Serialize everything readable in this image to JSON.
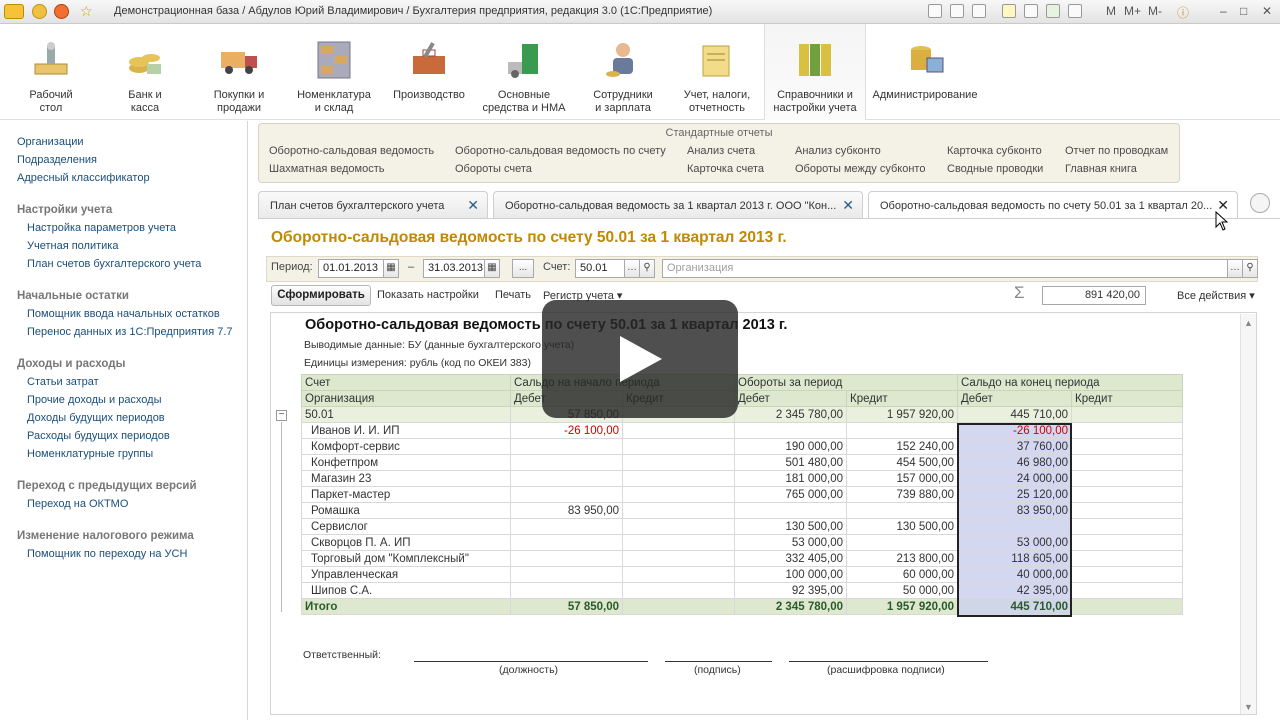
{
  "window": {
    "title": "Демонстрационная база / Абдулов Юрий Владимирович / Бухгалтерия предприятия, редакция 3.0  (1С:Предприятие)",
    "m_buttons": [
      "M",
      "M+",
      "M-"
    ]
  },
  "sections": [
    {
      "label": "Рабочий\nстол",
      "icon": "desktop-icon"
    },
    {
      "label": "Банк и\nкасса",
      "icon": "coins-icon"
    },
    {
      "label": "Покупки и\nпродажи",
      "icon": "truck-icon"
    },
    {
      "label": "Номенклатура\nи склад",
      "icon": "warehouse-icon"
    },
    {
      "label": "Производство",
      "icon": "toolbox-icon"
    },
    {
      "label": "Основные\nсредства и НМА",
      "icon": "fixed-assets-icon"
    },
    {
      "label": "Сотрудники\nи зарплата",
      "icon": "employee-icon"
    },
    {
      "label": "Учет, налоги,\nотчетность",
      "icon": "reports-icon"
    },
    {
      "label": "Справочники и\nнастройки учета",
      "icon": "binders-icon"
    },
    {
      "label": "Администрирование",
      "icon": "admin-icon"
    }
  ],
  "leftnav": {
    "top_links": [
      "Организации",
      "Подразделения",
      "Адресный классификатор"
    ],
    "groups": [
      {
        "title": "Настройки учета",
        "links": [
          "Настройка параметров учета",
          "Учетная политика",
          "План счетов бухгалтерского учета"
        ]
      },
      {
        "title": "Начальные остатки",
        "links": [
          "Помощник ввода начальных остатков",
          "Перенос данных из 1С:Предприятия 7.7"
        ]
      },
      {
        "title": "Доходы и расходы",
        "links": [
          "Статьи затрат",
          "Прочие доходы и расходы",
          "Доходы будущих периодов",
          "Расходы будущих периодов",
          "Номенклатурные группы"
        ]
      },
      {
        "title": "Переход с предыдущих версий",
        "links": [
          "Переход на ОКТМО"
        ]
      },
      {
        "title": "Изменение налогового режима",
        "links": [
          "Помощник по переходу на УСН"
        ]
      }
    ]
  },
  "std_reports": {
    "title": "Стандартные отчеты",
    "col1": [
      "Оборотно-сальдовая ведомость",
      "Шахматная ведомость"
    ],
    "col2": [
      "Оборотно-сальдовая ведомость по счету",
      "Обороты счета"
    ],
    "col3": [
      "Анализ счета",
      "Карточка счета"
    ],
    "col4": [
      "Анализ субконто",
      "Обороты между субконто"
    ],
    "col5": [
      "Карточка субконто",
      "Сводные проводки"
    ],
    "col6": [
      "Отчет по проводкам",
      "Главная книга"
    ]
  },
  "tabs": [
    {
      "label": "План счетов бухгалтерского учета"
    },
    {
      "label": "Оборотно-сальдовая ведомость за 1 квартал 2013 г. ООО \"Кон..."
    },
    {
      "label": "Оборотно-сальдовая ведомость по счету 50.01 за 1 квартал 20..."
    }
  ],
  "page_title": "Оборотно-сальдовая ведомость по счету 50.01 за 1 квартал 2013 г.",
  "filters": {
    "period_label": "Период:",
    "date_from": "01.01.2013",
    "dash": "–",
    "date_to": "31.03.2013",
    "ellipsis": "...",
    "account_label": "Счет:",
    "account": "50.01",
    "org_placeholder": "Организация"
  },
  "commands": {
    "generate": "Сформировать",
    "show_settings": "Показать настройки",
    "print": "Печать",
    "register": "Регистр учета",
    "sum_value": "891 420,00",
    "all_actions": "Все действия"
  },
  "report": {
    "title": "Оборотно-сальдовая ведомость по счету 50.01 за 1 квартал 2013 г.",
    "meta1": "Выводимые данные:   БУ (данные бухгалтерского учета)",
    "meta2": "Единицы измерения:   рубль (код по ОКЕИ 383)",
    "header1": [
      "Счет",
      "Сальдо на начало периода",
      "Обороты за период",
      "Сальдо на конец периода"
    ],
    "header2": [
      "Организация",
      "Дебет",
      "Кредит",
      "Дебет",
      "Кредит",
      "Дебет",
      "Кредит"
    ],
    "account_row": [
      "50.01",
      "57 850,00",
      "",
      "2 345 780,00",
      "1 957 920,00",
      "445 710,00",
      ""
    ],
    "rows": [
      [
        "Иванов И. И. ИП",
        "-26 100,00",
        "",
        "",
        "",
        "-26 100,00",
        ""
      ],
      [
        "Комфорт-сервис",
        "",
        "",
        "190 000,00",
        "152 240,00",
        "37 760,00",
        ""
      ],
      [
        "Конфетпром",
        "",
        "",
        "501 480,00",
        "454 500,00",
        "46 980,00",
        ""
      ],
      [
        "Магазин 23",
        "",
        "",
        "181 000,00",
        "157 000,00",
        "24 000,00",
        ""
      ],
      [
        "Паркет-мастер",
        "",
        "",
        "765 000,00",
        "739 880,00",
        "25 120,00",
        ""
      ],
      [
        "Ромашка",
        "83 950,00",
        "",
        "",
        "",
        "83 950,00",
        ""
      ],
      [
        "Сервислог",
        "",
        "",
        "130 500,00",
        "130 500,00",
        "",
        ""
      ],
      [
        "Скворцов П. А. ИП",
        "",
        "",
        "53 000,00",
        "",
        "53 000,00",
        ""
      ],
      [
        "Торговый дом \"Комплексный\"",
        "",
        "",
        "332 405,00",
        "213 800,00",
        "118 605,00",
        ""
      ],
      [
        "Управленческая",
        "",
        "",
        "100 000,00",
        "60 000,00",
        "40 000,00",
        ""
      ],
      [
        "Шипов С.А.",
        "",
        "",
        "92 395,00",
        "50 000,00",
        "42 395,00",
        ""
      ]
    ],
    "total_row": [
      "Итого",
      "57 850,00",
      "",
      "2 345 780,00",
      "1 957 920,00",
      "445 710,00",
      ""
    ],
    "responsible": "Ответственный:",
    "sig_position": "(должность)",
    "sig_signature": "(подпись)",
    "sig_decoding": "(расшифровка подписи)"
  },
  "colors": {
    "accent_title": "#c08a00",
    "table_header": "#dde8cf",
    "selection": "#d3d7f0",
    "negative": "#cc0000"
  }
}
